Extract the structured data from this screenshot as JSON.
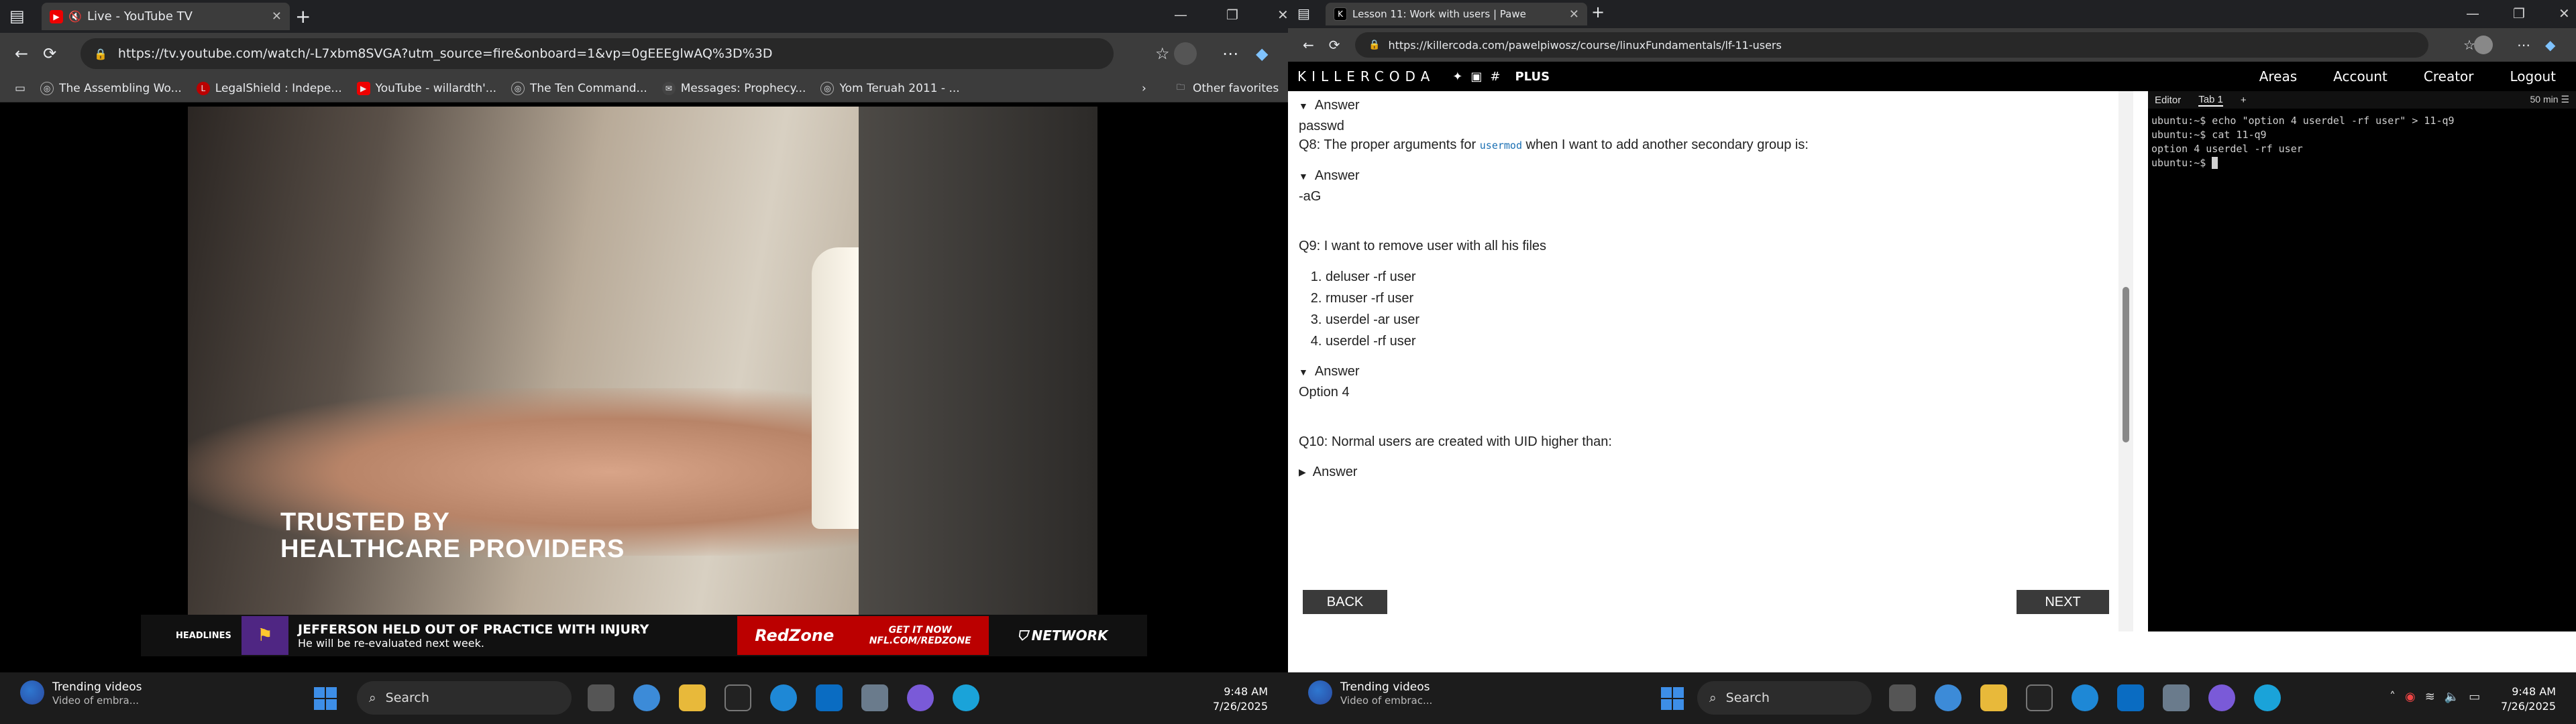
{
  "left": {
    "tab": {
      "title": "Live - YouTube TV"
    },
    "url": "https://tv.youtube.com/watch/-L7xbm8SVGA?utm_source=fire&onboard=1&vp=0gEEEglwAQ%3D%3D",
    "bookmarks": [
      "The Assembling Wo...",
      "LegalShield : Indepe...",
      "YouTube - willardth'...",
      "The Ten Command...",
      "Messages: Prophecy...",
      "Yom Teruah 2011 - ..."
    ],
    "other_favorites": "Other favorites",
    "video": {
      "overlay_line1": "TRUSTED BY",
      "overlay_line2": "HEALTHCARE PROVIDERS"
    },
    "ticker": {
      "headlines": "HEADLINES",
      "title": "JEFFERSON HELD OUT OF PRACTICE WITH INJURY",
      "subtitle": "He will be re-evaluated next week.",
      "redzone": "RedZone",
      "redzone_sub": "NFL NETWORK",
      "get_it": "GET IT NOW",
      "get_it_url": "NFL.COM/REDZONE",
      "network": "NETWORK"
    },
    "taskbar": {
      "weather_title": "Trending videos",
      "weather_sub": "Video of embra...",
      "search": "Search",
      "time": "9:48 AM",
      "date": "7/26/2025"
    }
  },
  "right": {
    "tab": {
      "title": "Lesson 11: Work with users | Pawe"
    },
    "url": "https://killercoda.com/pawelpiwosz/course/linuxFundamentals/lf-11-users",
    "header": {
      "logo": "KILLERCODA",
      "plus": "PLUS",
      "menu": [
        "Areas",
        "Account",
        "Creator",
        "Logout"
      ]
    },
    "lesson": {
      "answer_label": "Answer",
      "a7": "passwd",
      "q8_before": "Q8: The proper arguments for ",
      "q8_code": "usermod",
      "q8_after": " when I want to add another secondary group is:",
      "a8": "-aG",
      "q9": "Q9: I want to remove user with all his files",
      "q9_options": [
        "deluser -rf user",
        "rmuser -rf user",
        "userdel -ar user",
        "userdel -rf user"
      ],
      "a9": "Option 4",
      "q10": "Q10: Normal users are created with UID higher than:",
      "back": "BACK",
      "next": "NEXT"
    },
    "terminal": {
      "tabs": [
        "Editor",
        "Tab 1",
        "+"
      ],
      "timer": "50 min",
      "lines": [
        "ubuntu:~$ echo \"option 4 userdel -rf user\" > 11-q9",
        "ubuntu:~$ cat 11-q9",
        "option 4 userdel -rf user",
        "ubuntu:~$ "
      ]
    },
    "taskbar": {
      "weather_title": "Trending videos",
      "weather_sub": "Video of embrac...",
      "search": "Search",
      "time": "9:48 AM",
      "date": "7/26/2025"
    }
  }
}
